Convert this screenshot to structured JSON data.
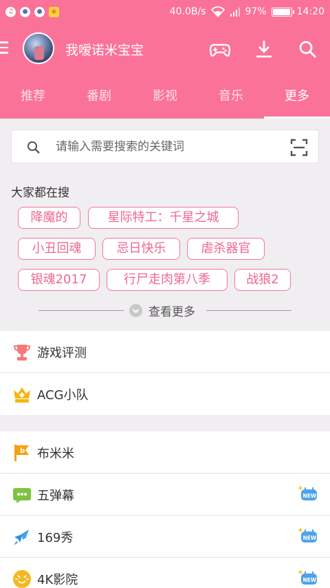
{
  "status_bar": {
    "network_speed": "40.0B/s",
    "battery_percent": "97%",
    "battery_level": 0.97,
    "time": "14:20",
    "notification_icons": [
      "music-app-icon",
      "chat-app-icon",
      "chat-app-icon",
      "camera-app-icon"
    ]
  },
  "app_bar": {
    "username": "我嗳诺米宝宝",
    "icons": [
      "menu-icon",
      "game-controller-icon",
      "download-icon",
      "search-icon"
    ]
  },
  "tabs": [
    "推荐",
    "番剧",
    "影视",
    "音乐",
    "更多"
  ],
  "active_tab": "更多",
  "search": {
    "placeholder": "请输入需要搜索的关键词"
  },
  "hot_search": {
    "title": "大家都在搜",
    "tags": [
      "降魔的",
      "星际特工：千星之城",
      "小丑回魂",
      "忌日快乐",
      "虐杀器官",
      "银魂2017",
      "行尸走肉第八季",
      "战狼2"
    ],
    "more_label": "查看更多"
  },
  "section1": [
    {
      "label": "游戏评测",
      "icon": "trophy-icon"
    },
    {
      "label": "ACG小队",
      "icon": "crown-icon"
    }
  ],
  "section2": [
    {
      "label": "布米米",
      "icon": "flag-icon",
      "new": false
    },
    {
      "label": "五弹幕",
      "icon": "chat-bubble-icon",
      "new": true
    },
    {
      "label": "169秀",
      "icon": "rocket-icon",
      "new": true
    },
    {
      "label": "4K影院",
      "icon": "cat-face-icon",
      "new": true
    }
  ],
  "new_badge_label": "NEW",
  "colors": {
    "brand": "#fb7299",
    "tag_border": "#f0779a",
    "background": "#f1eef1"
  }
}
